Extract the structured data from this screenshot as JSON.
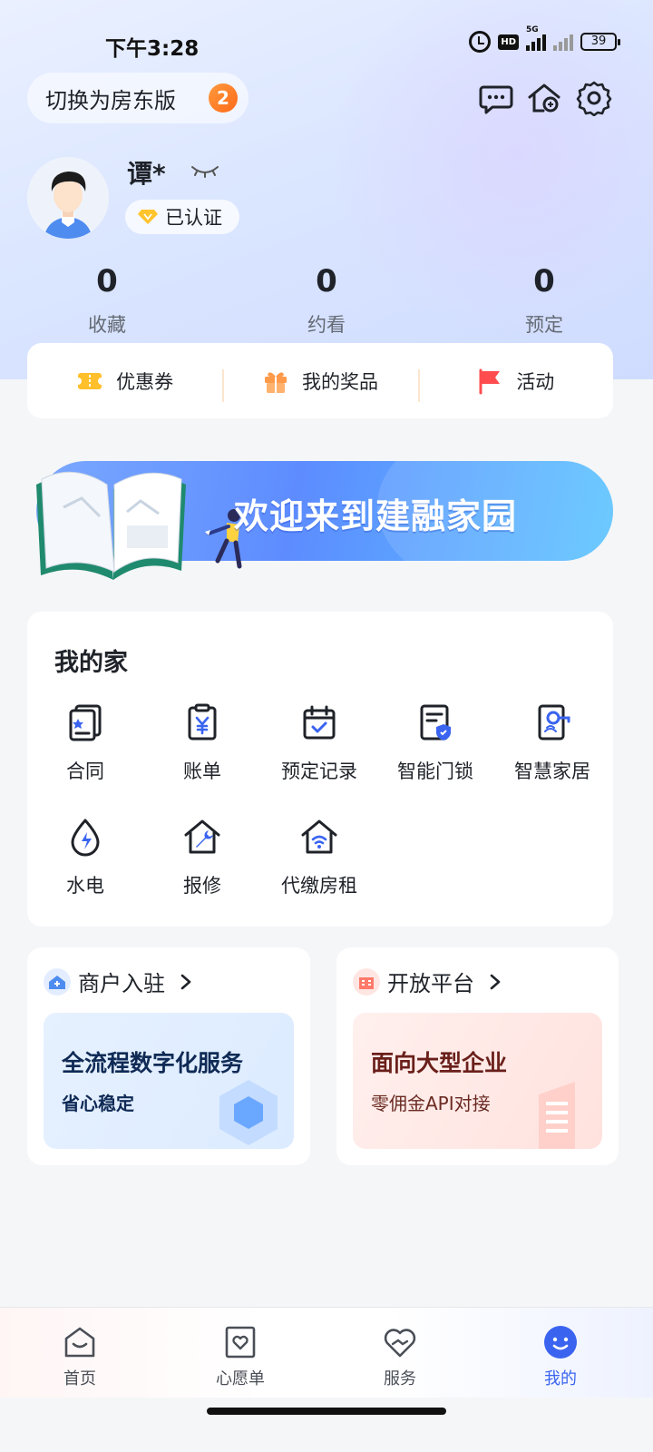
{
  "status": {
    "time": "下午3:28",
    "battery": "39",
    "hd": "HD",
    "network": "5G"
  },
  "header": {
    "switch_label": "切换为房东版",
    "switch_badge": "2",
    "icons": [
      "message-icon",
      "house-icon",
      "gear-icon"
    ]
  },
  "profile": {
    "name": "谭*",
    "verified_label": "已认证"
  },
  "stats": [
    {
      "value": "0",
      "label": "收藏"
    },
    {
      "value": "0",
      "label": "约看"
    },
    {
      "value": "0",
      "label": "预定"
    }
  ],
  "quick": [
    {
      "label": "优惠券",
      "icon": "coupon-icon"
    },
    {
      "label": "我的奖品",
      "icon": "gift-icon"
    },
    {
      "label": "活动",
      "icon": "flag-icon"
    }
  ],
  "banner": {
    "text": "欢迎来到建融家园"
  },
  "my_home": {
    "title": "我的家",
    "items": [
      {
        "label": "合同",
        "icon": "contract-icon"
      },
      {
        "label": "账单",
        "icon": "bill-icon"
      },
      {
        "label": "预定记录",
        "icon": "calendar-icon"
      },
      {
        "label": "智能门锁",
        "icon": "smart-lock-icon"
      },
      {
        "label": "智慧家居",
        "icon": "smart-home-icon"
      },
      {
        "label": "水电",
        "icon": "utility-icon"
      },
      {
        "label": "报修",
        "icon": "repair-icon"
      },
      {
        "label": "代缴房租",
        "icon": "rent-payment-icon"
      }
    ]
  },
  "promos": [
    {
      "title": "商户入驻",
      "big": "全流程数字化服务",
      "small": "省心稳定"
    },
    {
      "title": "开放平台",
      "big": "面向大型企业",
      "small": "零佣金API对接"
    }
  ],
  "tabs": [
    {
      "label": "首页",
      "icon": "home-tab-icon"
    },
    {
      "label": "心愿单",
      "icon": "wishlist-icon"
    },
    {
      "label": "服务",
      "icon": "service-icon"
    },
    {
      "label": "我的",
      "icon": "profile-tab-icon",
      "active": true
    }
  ],
  "colors": {
    "accent": "#3a64f0",
    "badge": "#ff7a22",
    "banner": "#5d8cff"
  }
}
